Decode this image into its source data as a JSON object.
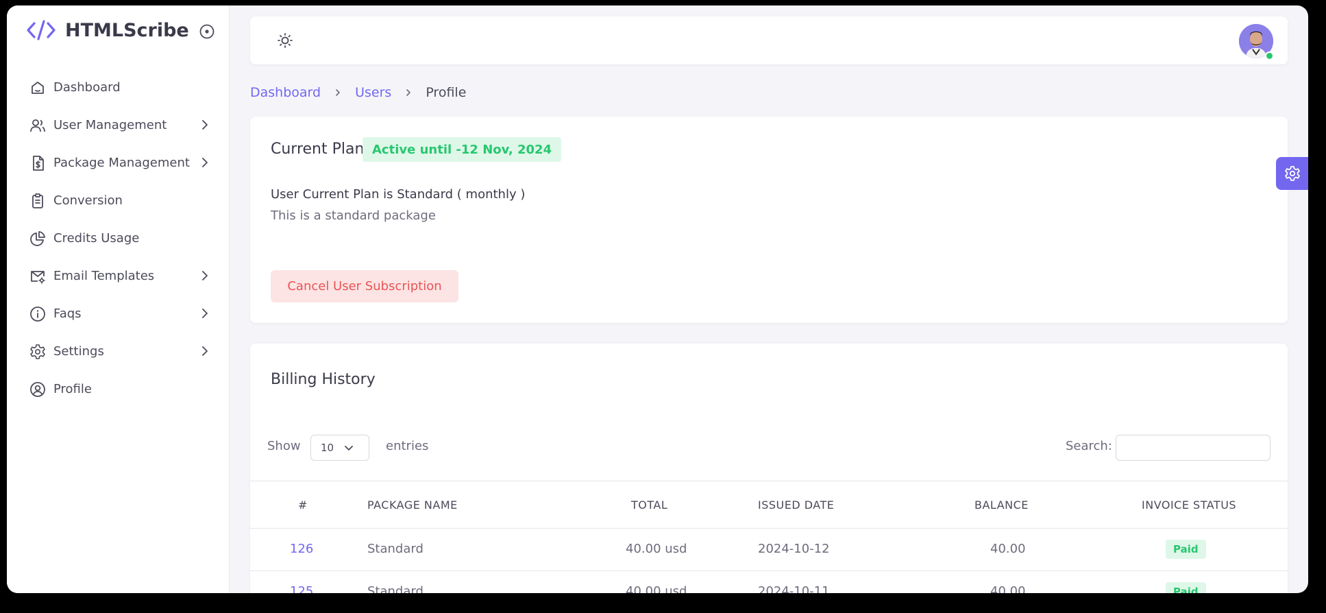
{
  "app": {
    "name": "HTMLScribe"
  },
  "sidebar": {
    "items": [
      {
        "label": "Dashboard",
        "icon": "home-icon",
        "has_children": false
      },
      {
        "label": "User Management",
        "icon": "users-icon",
        "has_children": true
      },
      {
        "label": "Package Management",
        "icon": "file-dollar-icon",
        "has_children": true
      },
      {
        "label": "Conversion",
        "icon": "clipboard-icon",
        "has_children": false
      },
      {
        "label": "Credits Usage",
        "icon": "pie-chart-icon",
        "has_children": false
      },
      {
        "label": "Email Templates",
        "icon": "mail-settings-icon",
        "has_children": true
      },
      {
        "label": "Faqs",
        "icon": "info-icon",
        "has_children": true
      },
      {
        "label": "Settings",
        "icon": "gear-icon",
        "has_children": true
      },
      {
        "label": "Profile",
        "icon": "user-circle-icon",
        "has_children": false
      }
    ]
  },
  "breadcrumb": {
    "items": [
      "Dashboard",
      "Users"
    ],
    "current": "Profile"
  },
  "plan": {
    "title": "Current Plan",
    "badge": "Active until -12 Nov, 2024",
    "description": "User Current Plan is Standard ( monthly )",
    "subdescription": "This is a standard package",
    "cancel_label": "Cancel User Subscription"
  },
  "billing": {
    "title": "Billing History",
    "show_label": "Show",
    "entries_value": "10",
    "entries_label": "entries",
    "search_label": "Search:",
    "columns": [
      "#",
      "PACKAGE NAME",
      "TOTAL",
      "ISSUED DATE",
      "BALANCE",
      "INVOICE STATUS"
    ],
    "rows": [
      {
        "id": "126",
        "package": "Standard",
        "total": "40.00 usd",
        "date": "2024-10-12",
        "balance": "40.00",
        "status": "Paid"
      },
      {
        "id": "125",
        "package": "Standard",
        "total": "40.00 usd",
        "date": "2024-10-11",
        "balance": "40.00",
        "status": "Paid"
      }
    ]
  },
  "colors": {
    "accent": "#7367f0",
    "success": "#28c76f",
    "danger": "#ea5455"
  }
}
